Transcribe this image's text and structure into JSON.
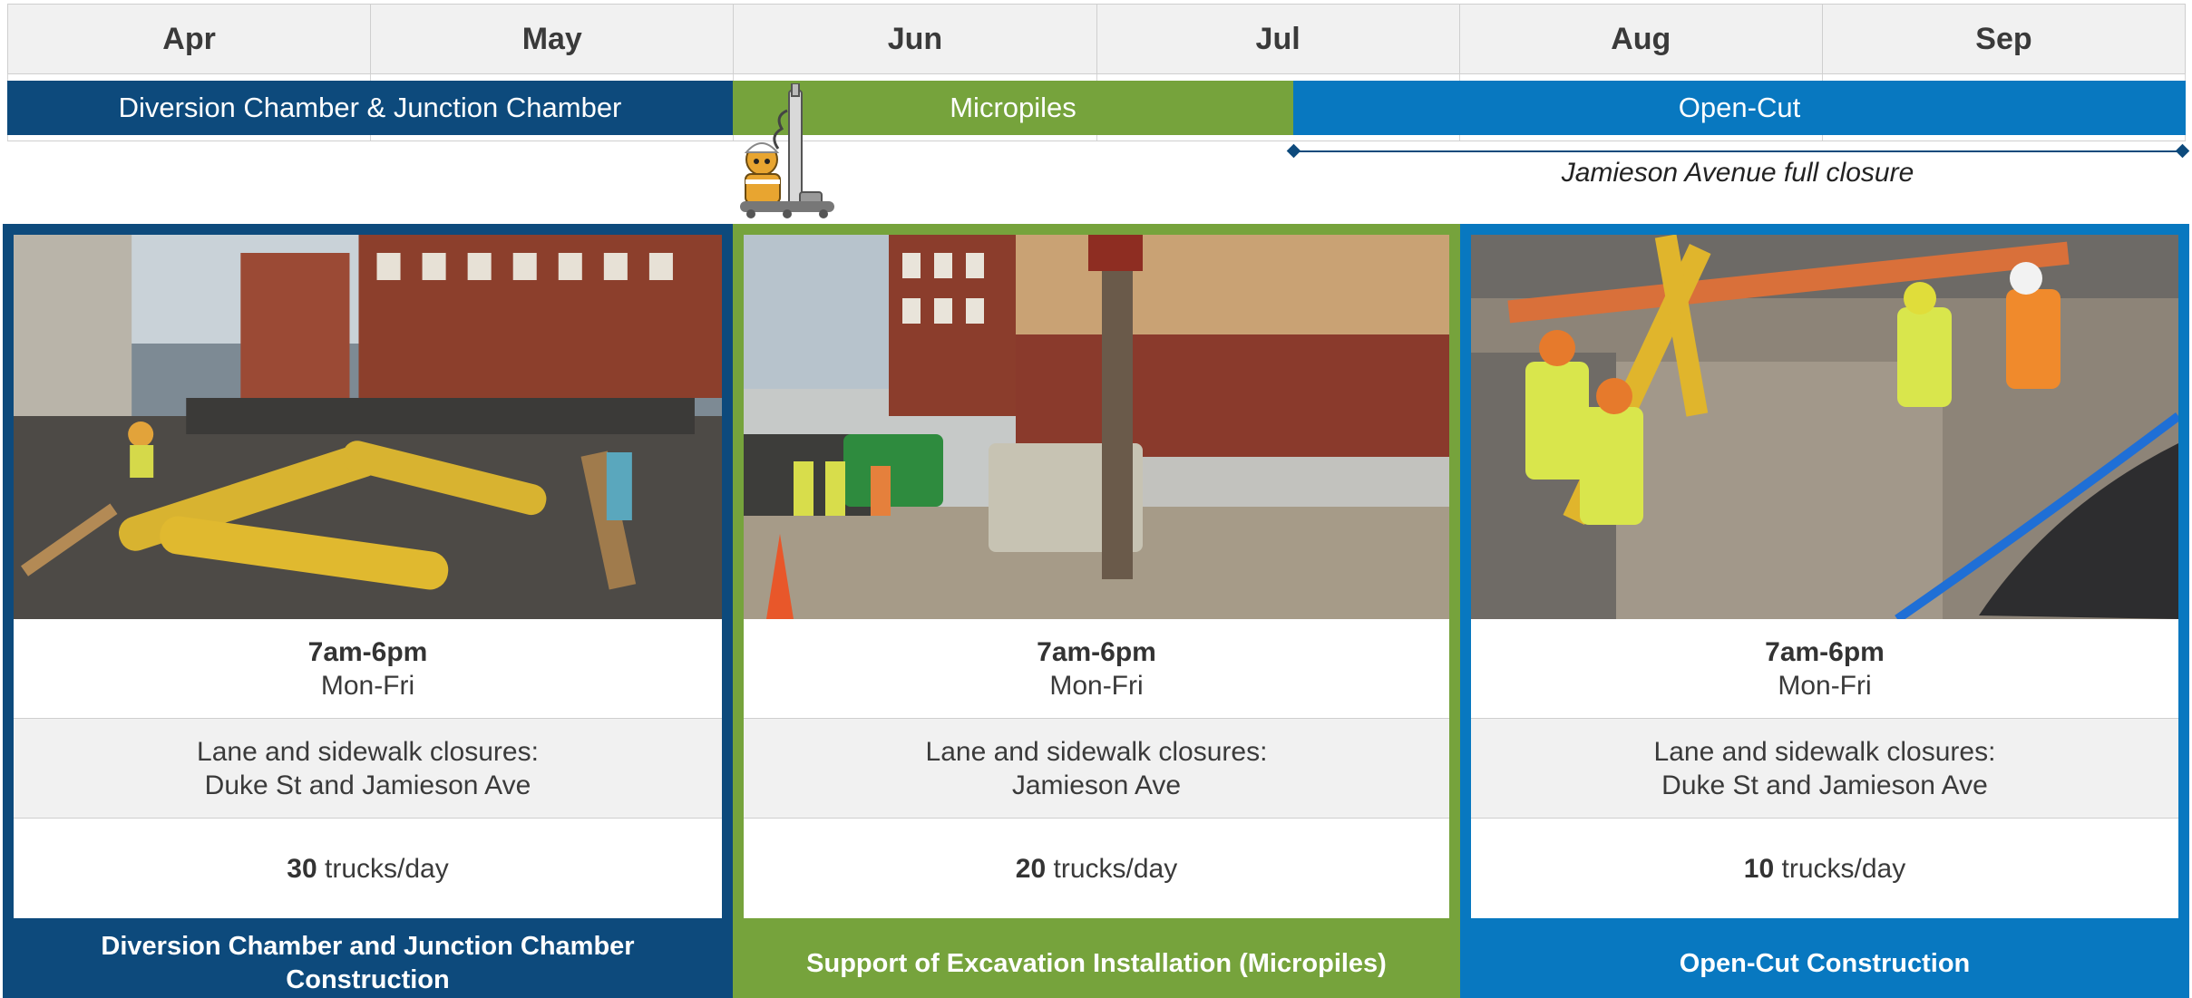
{
  "timeline": {
    "months": [
      "Apr",
      "May",
      "Jun",
      "Jul",
      "Aug",
      "Sep"
    ],
    "phases": [
      {
        "label": "Diversion Chamber & Junction Chamber",
        "color": "#0d4a7c"
      },
      {
        "label": "Micropiles",
        "color": "#76a33c"
      },
      {
        "label": "Open-Cut",
        "color": "#0878c0"
      }
    ],
    "closure_label": "Jamieson Avenue full closure"
  },
  "cards": [
    {
      "hours": "7am-6pm",
      "days": "Mon-Fri",
      "closure_heading": "Lane and sidewalk closures:",
      "closure_streets": "Duke St and Jamieson Ave",
      "trucks": "30",
      "trucks_unit": "trucks/day",
      "title": "Diversion Chamber and Junction Chamber Construction",
      "color": "#0d4a7c",
      "photo_icon": "construction-site-photo"
    },
    {
      "hours": "7am-6pm",
      "days": "Mon-Fri",
      "closure_heading": "Lane and sidewalk closures:",
      "closure_streets": "Jamieson Ave",
      "trucks": "20",
      "trucks_unit": "trucks/day",
      "title": "Support of Excavation Installation (Micropiles)",
      "color": "#76a33c",
      "photo_icon": "drill-rig-photo"
    },
    {
      "hours": "7am-6pm",
      "days": "Mon-Fri",
      "closure_heading": "Lane and sidewalk closures:",
      "closure_streets": "Duke St and Jamieson Ave",
      "trucks": "10",
      "trucks_unit": "trucks/day",
      "title": "Open-Cut Construction",
      "color": "#0878c0",
      "photo_icon": "excavation-crew-photo"
    }
  ]
}
